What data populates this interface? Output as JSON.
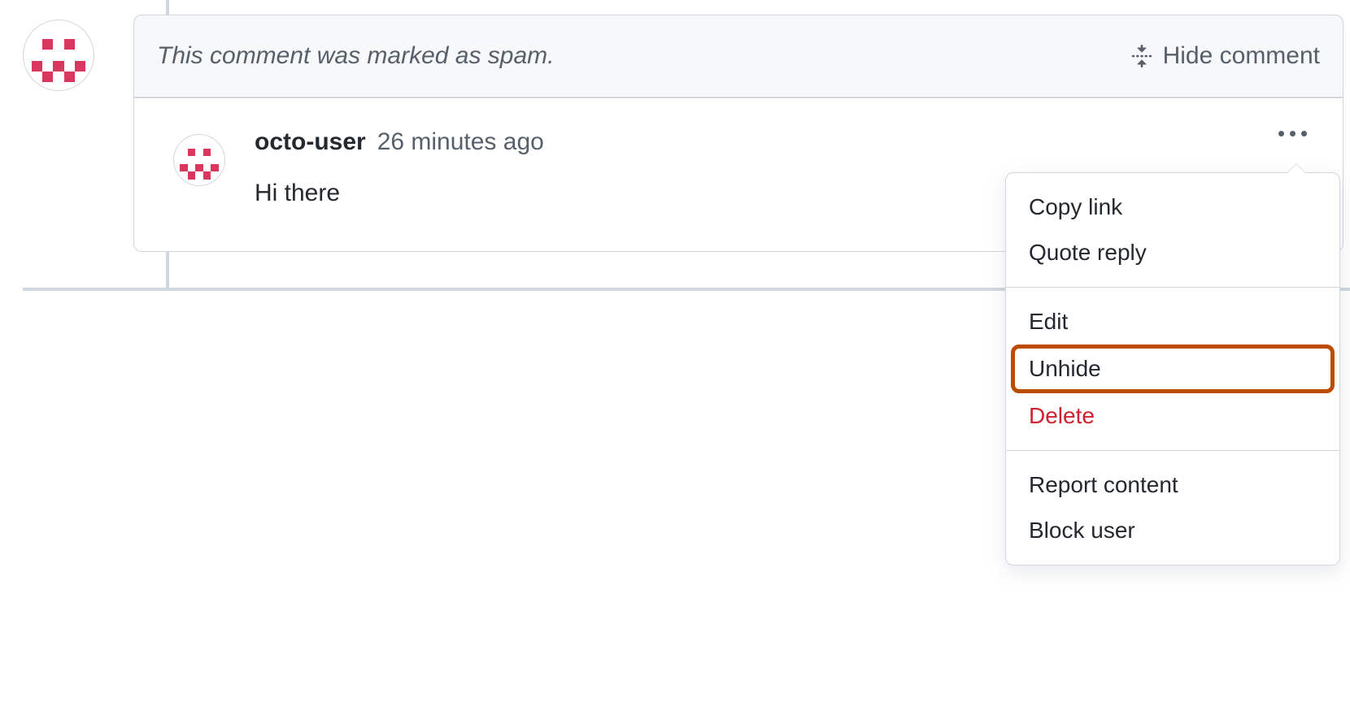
{
  "banner": {
    "notice": "This comment was marked as spam.",
    "hide_label": "Hide comment"
  },
  "comment": {
    "username": "octo-user",
    "timestamp": "26 minutes ago",
    "body": "Hi there"
  },
  "menu": {
    "copy_link": "Copy link",
    "quote_reply": "Quote reply",
    "edit": "Edit",
    "unhide": "Unhide",
    "delete": "Delete",
    "report_content": "Report content",
    "block_user": "Block user"
  },
  "identicon_cells": [
    0,
    0,
    0,
    0,
    0,
    0,
    1,
    0,
    1,
    0,
    0,
    0,
    0,
    0,
    0,
    1,
    0,
    1,
    0,
    1,
    0,
    1,
    0,
    1,
    0
  ]
}
